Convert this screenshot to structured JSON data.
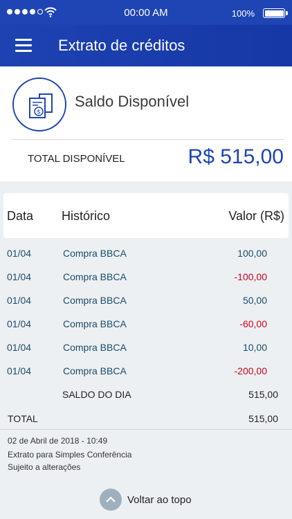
{
  "status_bar": {
    "time": "00:00 AM",
    "battery": "100%"
  },
  "header": {
    "title": "Extrato de créditos"
  },
  "balance": {
    "title": "Saldo Disponível",
    "total_label": "TOTAL DISPONÍVEL",
    "total_value": "R$ 515,00"
  },
  "table": {
    "headers": {
      "date": "Data",
      "history": "Histórico",
      "value": "Valor (R$)"
    },
    "rows": [
      {
        "date": "01/04",
        "history": "Compra BBCA",
        "value": "100,00"
      },
      {
        "date": "01/04",
        "history": "Compra BBCA",
        "value": "-100,00"
      },
      {
        "date": "01/04",
        "history": "Compra BBCA",
        "value": "50,00"
      },
      {
        "date": "01/04",
        "history": "Compra BBCA",
        "value": "-60,00"
      },
      {
        "date": "01/04",
        "history": "Compra BBCA",
        "value": "10,00"
      },
      {
        "date": "01/04",
        "history": "Compra BBCA",
        "value": "-200,00"
      }
    ],
    "day_balance": {
      "label": "SALDO DO DIA",
      "value": "515,00"
    },
    "total": {
      "label": "TOTAL",
      "value": "515,00"
    }
  },
  "footer": {
    "timestamp": "02 de Abril de 2018 - 10:49",
    "note1": "Extrato para Simples Conferência",
    "note2": "Sujeito a alterações",
    "back_to_top": "Voltar ao topo"
  },
  "colors": {
    "primary": "#1f45b4",
    "negative": "#d0021b",
    "value_text": "#1a4b6a",
    "list_bg": "#ecf0f3"
  },
  "icons": [
    "wifi-icon",
    "menu-icon",
    "document-money-icon",
    "chevron-up-icon"
  ]
}
